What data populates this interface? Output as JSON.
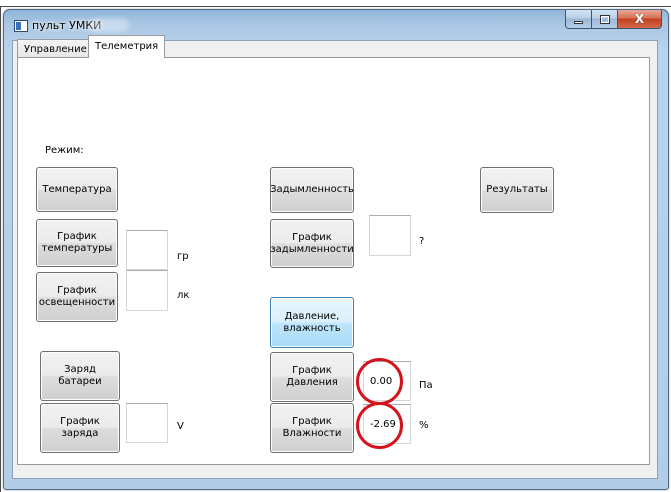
{
  "window": {
    "title": "пульт УМКИ",
    "controls": {
      "minimize": "–",
      "maximize": "□",
      "close": "X"
    }
  },
  "tabs": [
    {
      "label": "Управление",
      "selected": false
    },
    {
      "label": "Телеметрия",
      "selected": true
    }
  ],
  "panel": {
    "mode_label": "Режим:",
    "left_column": {
      "temperature_button": "Температура",
      "temperature_graph_button": "График\nтемпературы",
      "temperature_value": "",
      "temperature_unit": "гр",
      "light_graph_button": "График\nосвещенности",
      "light_value": "",
      "light_unit": "лк",
      "battery_button": "Заряд\nбатареи",
      "charge_graph_button": "График\nзаряда",
      "charge_value": "",
      "charge_unit": "V"
    },
    "middle_column": {
      "smoke_button": "Задымленность",
      "smoke_graph_button": "График\nзадымленности",
      "smoke_value": "",
      "smoke_unit": "?",
      "pressure_humidity_button": "Давление,\nвлажность",
      "pressure_graph_button": "График\nДавления",
      "pressure_value": "0.00",
      "pressure_unit": "Па",
      "humidity_graph_button": "График\nВлажности",
      "humidity_value": "-2.69",
      "humidity_unit": "%"
    },
    "right_column": {
      "results_button": "Результаты"
    }
  },
  "colors": {
    "annotation_circle": "#d4141c",
    "active_button": "#bee6fd",
    "titlebar": "#a9c7e4"
  }
}
